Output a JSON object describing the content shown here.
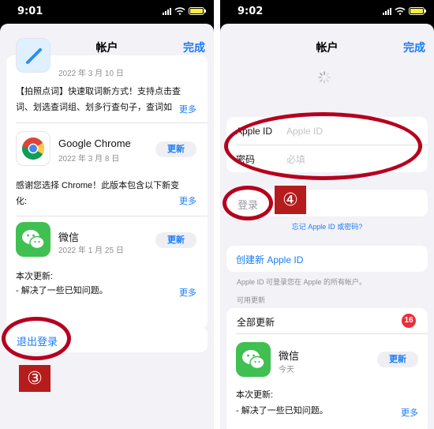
{
  "left": {
    "time": "9:01",
    "title": "帐户",
    "done": "完成",
    "apps": [
      {
        "date": "2022 年 3 月 10 日",
        "desc_line1": "【拍照点词】快速取词新方式！支持点击查",
        "desc_line2": "词、划选查词组、划多行查句子，查词如",
        "more": "更多"
      },
      {
        "name": "Google Chrome",
        "date": "2022 年 3 月 8 日",
        "button": "更新",
        "icon": "chrome-icon",
        "desc_line1": "感谢您选择 Chrome！此版本包含以下新变",
        "desc_line2": "化:",
        "more": "更多"
      },
      {
        "name": "微信",
        "date": "2022 年 1 月 25 日",
        "button": "更新",
        "icon": "wechat-icon",
        "desc_line1": "本次更新:",
        "desc_line2": "- 解决了一些已知问题。",
        "more": "更多"
      }
    ],
    "signout": "退出登录",
    "annotation": "③",
    "accent": "#1a7cf5",
    "annotation_color": "#b5001d"
  },
  "right": {
    "time": "9:02",
    "title": "帐户",
    "done": "完成",
    "apple_id_label": "Apple ID",
    "apple_id_placeholder": "Apple ID",
    "password_label": "密码",
    "password_placeholder": "必填",
    "signin": "登录",
    "annotation": "④",
    "forgot": "忘记 Apple ID 或密码?",
    "create": "创建新 Apple ID",
    "create_note": "Apple ID 可登录您在 Apple 的所有帐户。",
    "available_updates": "可用更新",
    "update_all": "全部更新",
    "update_count": "16",
    "app": {
      "name": "微信",
      "date": "今天",
      "button": "更新",
      "icon": "wechat-icon",
      "desc_line1": "本次更新:",
      "desc_line2": "- 解决了一些已知问题。",
      "more": "更多"
    }
  }
}
